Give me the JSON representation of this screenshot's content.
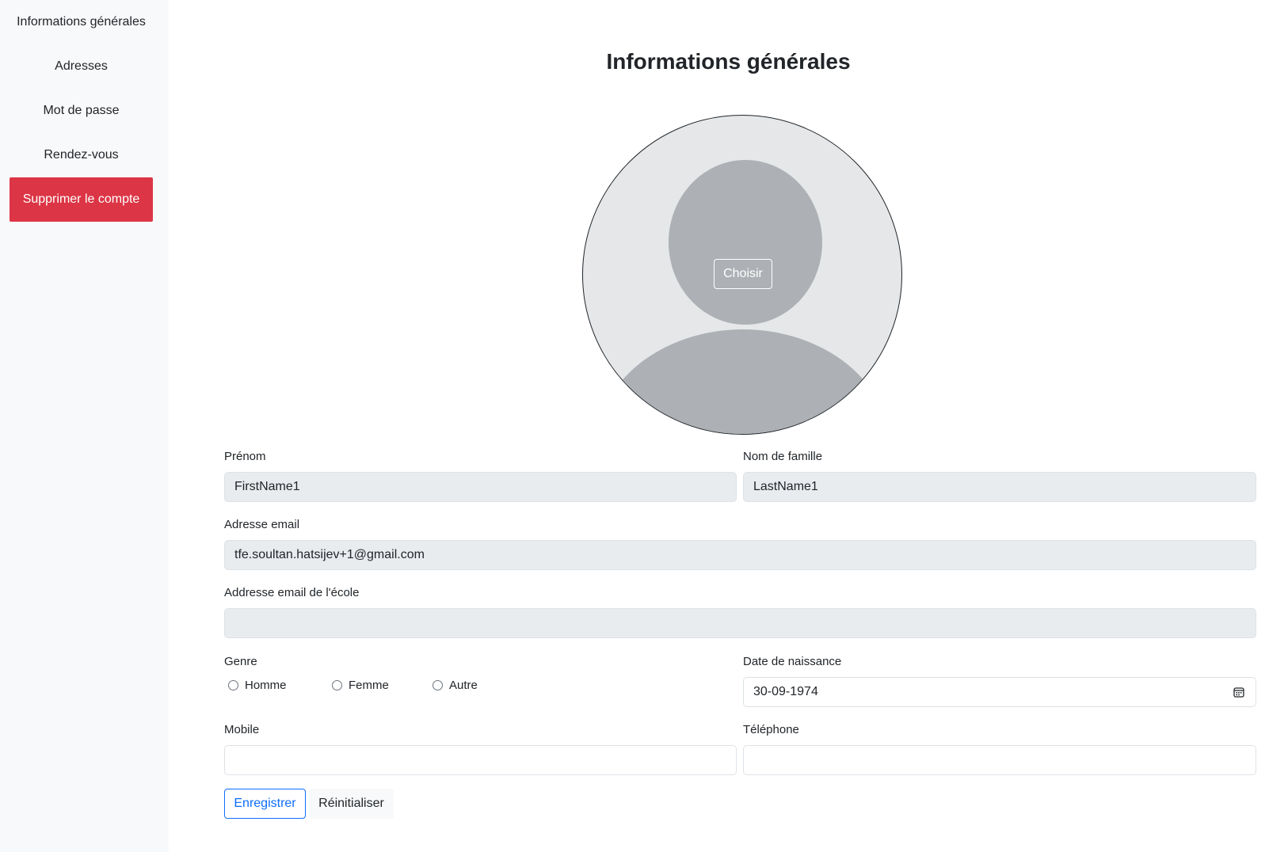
{
  "sidebar": {
    "items": [
      {
        "label": "Informations générales"
      },
      {
        "label": "Adresses"
      },
      {
        "label": "Mot de passe"
      },
      {
        "label": "Rendez-vous"
      },
      {
        "label": "Supprimer le compte"
      }
    ]
  },
  "page": {
    "title": "Informations générales"
  },
  "avatar": {
    "choose_label": "Choisir"
  },
  "form": {
    "first_name": {
      "label": "Prénom",
      "value": "FirstName1"
    },
    "last_name": {
      "label": "Nom de famille",
      "value": "LastName1"
    },
    "email": {
      "label": "Adresse email",
      "value": "tfe.soultan.hatsijev+1@gmail.com"
    },
    "school_email": {
      "label": "Addresse email de l'école",
      "value": ""
    },
    "gender": {
      "label": "Genre",
      "options": [
        {
          "label": "Homme"
        },
        {
          "label": "Femme"
        },
        {
          "label": "Autre"
        }
      ]
    },
    "birth_date": {
      "label": "Date de naissance",
      "value": "30-09-1974"
    },
    "mobile": {
      "label": "Mobile",
      "value": ""
    },
    "phone": {
      "label": "Téléphone",
      "value": ""
    },
    "save_label": "Enregistrer",
    "reset_label": "Réinitialiser"
  },
  "colors": {
    "danger": "#dc3545",
    "primary": "#0d6efd",
    "readonly_bg": "#e9ecef",
    "sidebar_bg": "#f8f9fa"
  }
}
